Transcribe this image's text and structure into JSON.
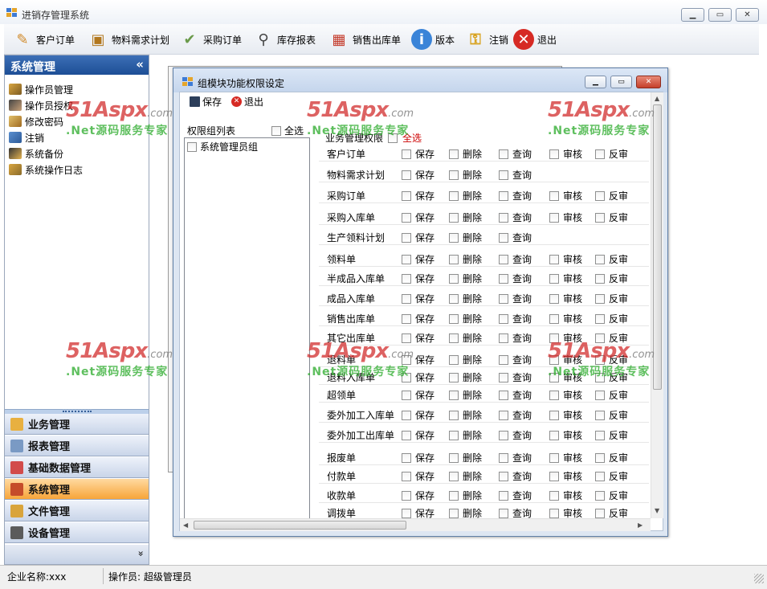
{
  "window": {
    "title": "进销存管理系统"
  },
  "toolbar": {
    "items": [
      {
        "label": "客户订单",
        "icon": "customer-order-icon"
      },
      {
        "label": "物料需求计划",
        "icon": "material-plan-icon"
      },
      {
        "label": "采购订单",
        "icon": "purchase-order-icon"
      },
      {
        "label": "库存报表",
        "icon": "magnifier-icon"
      },
      {
        "label": "销售出库单",
        "icon": "calendar-icon"
      },
      {
        "label": "版本",
        "icon": "info-icon"
      },
      {
        "label": "注销",
        "icon": "key-icon"
      },
      {
        "label": "退出",
        "icon": "close-red-icon"
      }
    ]
  },
  "sidebar": {
    "title": "系统管理",
    "collapse": "«",
    "items": [
      {
        "label": "操作员管理"
      },
      {
        "label": "操作员授权"
      },
      {
        "label": "修改密码"
      },
      {
        "label": "注销"
      },
      {
        "label": "系统备份"
      },
      {
        "label": "系统操作日志"
      }
    ],
    "nav": [
      {
        "label": "业务管理",
        "color": "#e8b040"
      },
      {
        "label": "报表管理",
        "color": "#7a9ac4"
      },
      {
        "label": "基础数据管理",
        "color": "#d24b4b"
      },
      {
        "label": "系统管理",
        "color": "#c54c2a"
      },
      {
        "label": "文件管理",
        "color": "#d9a43b"
      },
      {
        "label": "设备管理",
        "color": "#5b5b5b"
      }
    ],
    "more": "»"
  },
  "status": {
    "company": "企业名称:xxx",
    "operator": "操作员: 超级管理员"
  },
  "dialog": {
    "title": "组模块功能权限设定",
    "save": "保存",
    "exit": "退出",
    "group_label": "权限组列表",
    "group_select_all": "全选",
    "groups": [
      {
        "label": "系统管理员组"
      }
    ],
    "perm_header": "业务管理权限",
    "perm_select_all": "全选",
    "ops": [
      "保存",
      "删除",
      "查询",
      "审核",
      "反审"
    ],
    "rows": [
      {
        "name": "客户订单",
        "n": 5
      },
      {
        "name": "物料需求计划",
        "n": 3
      },
      {
        "name": "采购订单",
        "n": 5
      },
      {
        "name": "采购入库单",
        "n": 5
      },
      {
        "name": "生产领料计划",
        "n": 3
      },
      {
        "name": "领料单",
        "n": 5
      },
      {
        "name": "半成品入库单",
        "n": 5
      },
      {
        "name": "成品入库单",
        "n": 5
      },
      {
        "name": "销售出库单",
        "n": 5
      },
      {
        "name": "其它出库单",
        "n": 5
      },
      {
        "name": "退料单",
        "n": 5
      },
      {
        "name": "退料入库单",
        "n": 5
      },
      {
        "name": "超领单",
        "n": 5
      },
      {
        "name": "委外加工入库单",
        "n": 5
      },
      {
        "name": "委外加工出库单",
        "n": 5
      },
      {
        "name": "报废单",
        "n": 5
      },
      {
        "name": "付款单",
        "n": 5
      },
      {
        "name": "收款单",
        "n": 5
      },
      {
        "name": "调拨单",
        "n": 5
      }
    ]
  },
  "watermark": {
    "brand": "51Aspx",
    "domain": ".com",
    "slogan": ".Net源码服务专家"
  }
}
